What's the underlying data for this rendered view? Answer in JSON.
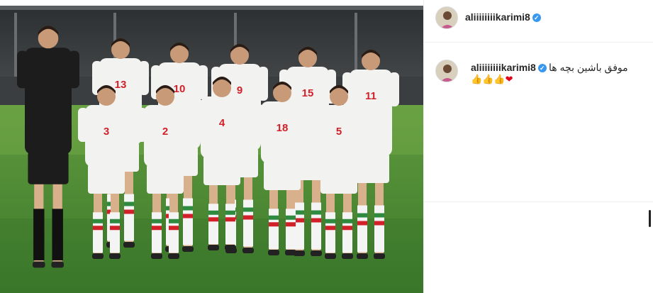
{
  "post": {
    "username": "aliiiiiiiikarimi8",
    "verified": true,
    "caption_text": "موفق باشين بچه ها",
    "caption_emoji": [
      {
        "name": "thumbs-up",
        "glyph": "👍"
      },
      {
        "name": "thumbs-up",
        "glyph": "👍"
      },
      {
        "name": "thumbs-up",
        "glyph": "👍"
      },
      {
        "name": "heart",
        "glyph": "❤"
      }
    ]
  },
  "photo": {
    "players": [
      {
        "number": ""
      },
      {
        "number": "13"
      },
      {
        "number": "10"
      },
      {
        "number": "9"
      },
      {
        "number": "15"
      },
      {
        "number": "11"
      },
      {
        "number": "3"
      },
      {
        "number": "2"
      },
      {
        "number": "4"
      },
      {
        "number": "18"
      },
      {
        "number": "5"
      }
    ]
  },
  "colors": {
    "accent": "#3897f0",
    "heart": "#e0001b",
    "border": "#efefef",
    "kit_white": "#f2f2f0",
    "kit_red": "#d2202a",
    "kit_green": "#2d8a3e"
  }
}
